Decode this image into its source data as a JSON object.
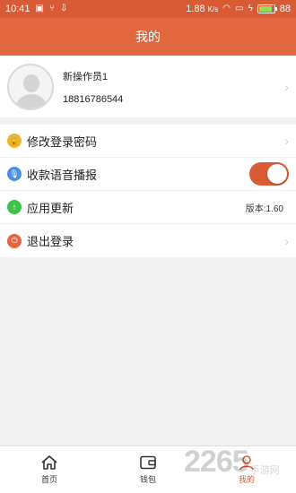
{
  "status_bar": {
    "time": "10:41",
    "speed": "1.88",
    "speed_unit": "K/s",
    "battery": "88",
    "battery_level": 0.88,
    "icons": [
      "image-icon",
      "usb-icon",
      "download-icon",
      "wifi-icon",
      "sim-icon",
      "charging-icon"
    ]
  },
  "title_bar": {
    "title": "我的"
  },
  "profile": {
    "name": "新操作员1",
    "phone": "18816786544",
    "chevron": "›"
  },
  "menu": {
    "items": [
      {
        "label": "修改登录密码",
        "icon": "lock-icon",
        "icon_color": "#f0b429",
        "icon_glyph": "🔒",
        "chevron": "›"
      },
      {
        "label": "收款语音播报",
        "icon": "microphone-icon",
        "icon_color": "#4a90e2",
        "icon_glyph": "🎙",
        "toggle_on": true
      },
      {
        "label": "应用更新",
        "icon": "upload-icon",
        "icon_color": "#3cc24a",
        "icon_glyph": "↑",
        "value": "版本:1.60"
      },
      {
        "label": "退出登录",
        "icon": "power-icon",
        "icon_color": "#e2673f",
        "icon_glyph": "⏻",
        "chevron": "›"
      }
    ]
  },
  "tab_bar": {
    "tabs": [
      {
        "label": "首页",
        "icon": "home-icon",
        "active": false
      },
      {
        "label": "钱包",
        "icon": "wallet-icon",
        "active": false
      },
      {
        "label": "我的",
        "icon": "person-icon",
        "active": true
      }
    ]
  },
  "watermark": {
    "big": "2265",
    "small": "手游网"
  },
  "colors": {
    "accent": "#e2673f",
    "status_bar": "#d95b35",
    "background": "#f2f2f2"
  }
}
